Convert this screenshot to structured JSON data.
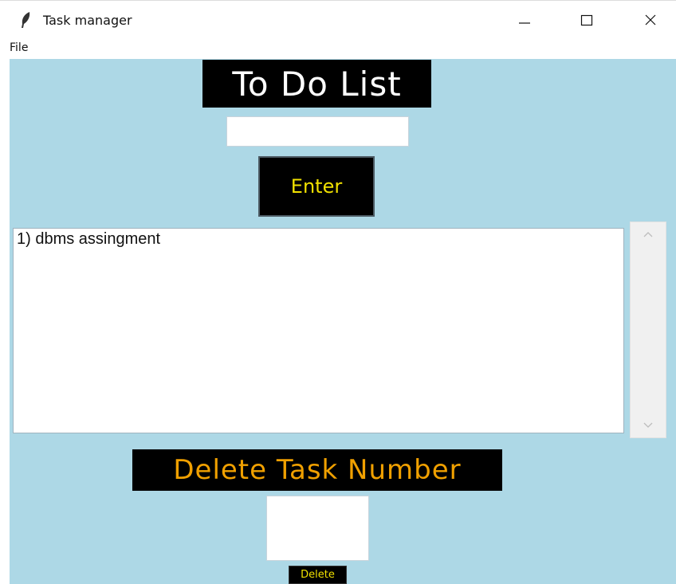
{
  "window": {
    "title": "Task manager",
    "icon": "feather-icon"
  },
  "menu": {
    "items": [
      "File"
    ]
  },
  "app": {
    "heading": "To Do List",
    "task_input": {
      "value": "",
      "placeholder": ""
    },
    "enter_label": "Enter",
    "tasks": [
      "1) dbms assingment"
    ],
    "delete_heading": "Delete Task Number",
    "delete_input": {
      "value": "",
      "placeholder": ""
    },
    "delete_label": "Delete"
  },
  "colors": {
    "background": "#add8e6",
    "heading_bg": "#000000",
    "heading_text": "#ffffff",
    "button_text": "#f0e000",
    "delete_heading_text": "#f0a000"
  }
}
